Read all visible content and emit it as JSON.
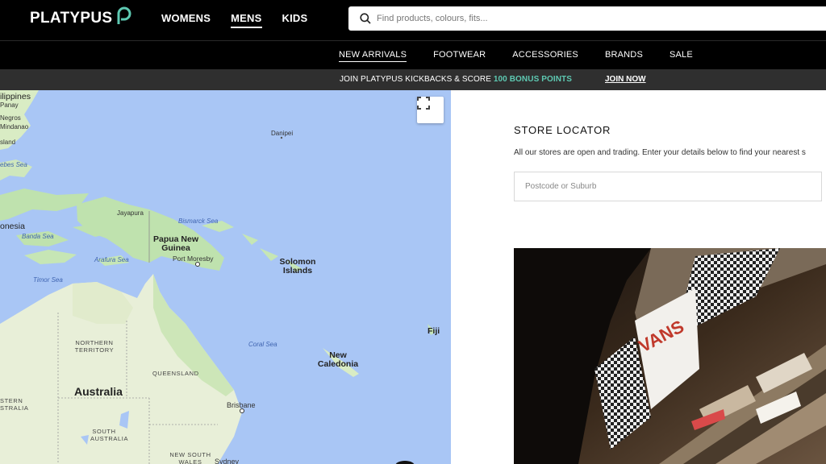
{
  "header": {
    "logo_text": "PLATYPUS",
    "gender_nav": [
      {
        "label": "WOMENS",
        "active": false
      },
      {
        "label": "MENS",
        "active": true
      },
      {
        "label": "KIDS",
        "active": false
      }
    ],
    "search": {
      "placeholder": "Find products, colours, fits...",
      "value": "",
      "icon": "search-icon"
    }
  },
  "category_nav": {
    "items": [
      {
        "label": "NEW ARRIVALS",
        "active": true
      },
      {
        "label": "FOOTWEAR",
        "active": false
      },
      {
        "label": "ACCESSORIES",
        "active": false
      },
      {
        "label": "BRANDS",
        "active": false
      },
      {
        "label": "SALE",
        "active": false
      }
    ]
  },
  "promo": {
    "text_before": "JOIN PLATYPUS KICKBACKS & SCORE",
    "highlight": "100 BONUS POINTS",
    "link": "JOIN NOW",
    "highlight_color": "#5ec9b2"
  },
  "map": {
    "fullscreen_icon": "fullscreen-icon",
    "labels": {
      "philippines": "ilippines",
      "panay": "Panay",
      "negros": "Negros",
      "mindanao": "Mindanao",
      "island": "sland",
      "celebes_sea": "ebes Sea",
      "danipei": "Danipei",
      "jayapura": "Jayapura",
      "bismarck_sea": "Bismarck Sea",
      "indonesia": "onesia",
      "banda_sea": "Banda Sea",
      "papua_new_guinea": "Papua New Guinea",
      "port_moresby": "Port Moresby",
      "arafura_sea": "Arafura Sea",
      "solomon_islands": "Solomon Islands",
      "timor_sea": "Timor Sea",
      "fiji": "Fiji",
      "northern_territory": "NORTHERN TERRITORY",
      "coral_sea": "Coral Sea",
      "new_caledonia": "New Caledonia",
      "queensland": "QUEENSLAND",
      "australia": "Australia",
      "western_australia": "STERN STRALIA",
      "brisbane": "Brisbane",
      "south_australia": "SOUTH AUSTRALIA",
      "new_south_wales": "NEW SOUTH WALES",
      "sydney": "Sydney"
    }
  },
  "locator": {
    "title": "STORE LOCATOR",
    "description": "All our stores are open and trading. Enter your details below to find your nearest s",
    "input_placeholder": "Postcode or Suburb",
    "input_value": ""
  }
}
